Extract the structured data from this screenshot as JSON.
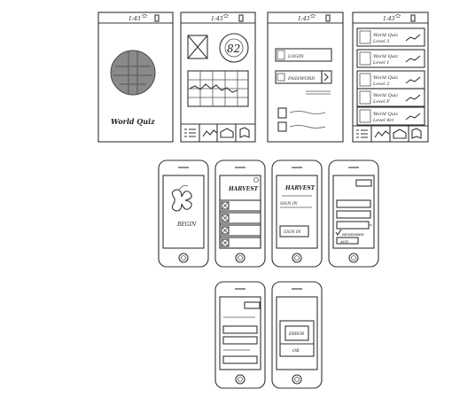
{
  "top_row": {
    "status_time": "1:43",
    "screen1": {
      "title": "World Quiz"
    },
    "screen2": {
      "score": "82"
    },
    "screen3": {
      "login_label": "LOGIN",
      "password_label": "PASSWORD"
    },
    "screen4": {
      "rows": [
        {
          "line1": "World Quiz",
          "line2": "Level 3"
        },
        {
          "line1": "World Quiz",
          "line2": "Level 1"
        },
        {
          "line1": "World Quiz",
          "line2": "Level 2"
        },
        {
          "line1": "World Quiz",
          "line2": "Level F"
        },
        {
          "line1": "World Quiz",
          "line2": "Level 4ct"
        }
      ]
    }
  },
  "middle_row": {
    "phone1": {
      "button": "BEGIN"
    },
    "phone2": {
      "title": "HARVEST"
    },
    "phone3": {
      "title": "HARVEST",
      "label": "SIGN IN",
      "button": "SIGN IN"
    },
    "phone4": {
      "checkbox_label": "REMEMBER",
      "button": "ADD"
    }
  },
  "bottom_row": {
    "phone2": {
      "dialog_text": "ERROR",
      "ok": "OK"
    }
  }
}
